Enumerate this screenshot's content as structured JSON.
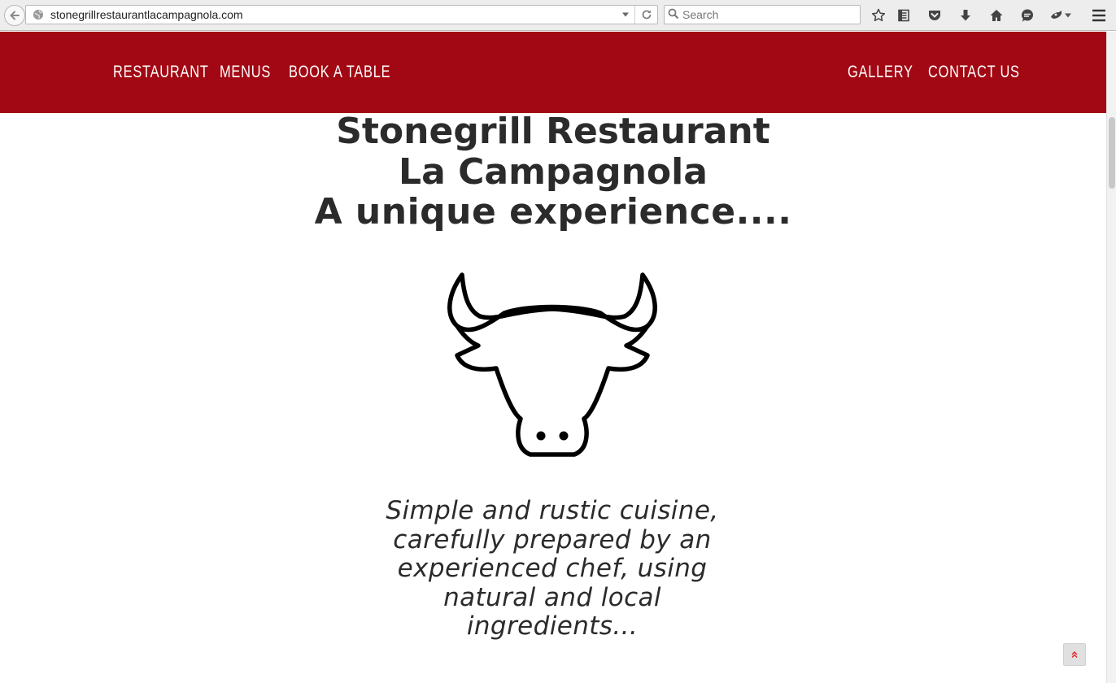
{
  "browser": {
    "url": "stonegrillrestaurantlacampagnola.com",
    "search_placeholder": "Search",
    "toolbar_icons": [
      "bookmark-star-icon",
      "reading-list-icon",
      "pocket-icon",
      "download-icon",
      "home-icon",
      "chat-icon",
      "extension-icon",
      "menu-icon"
    ]
  },
  "site_nav": {
    "color": "#a20813",
    "left_items": [
      {
        "label": "RESTAURANT"
      },
      {
        "label": "MENUS"
      },
      {
        "label": "BOOK A TABLE"
      }
    ],
    "right_items": [
      {
        "label": "GALLERY"
      },
      {
        "label": "CONTACT US"
      }
    ]
  },
  "hero": {
    "title": "Stonegrill Restaurant La Campagnola",
    "subtitle": "A unique experience....",
    "logo_icon": "bull-head-icon",
    "tagline": "Simple and rustic cuisine, carefully prepared by an experienced chef, using natural and local ingredients..."
  },
  "back_to_top_icon": "double-chevron-up-icon"
}
